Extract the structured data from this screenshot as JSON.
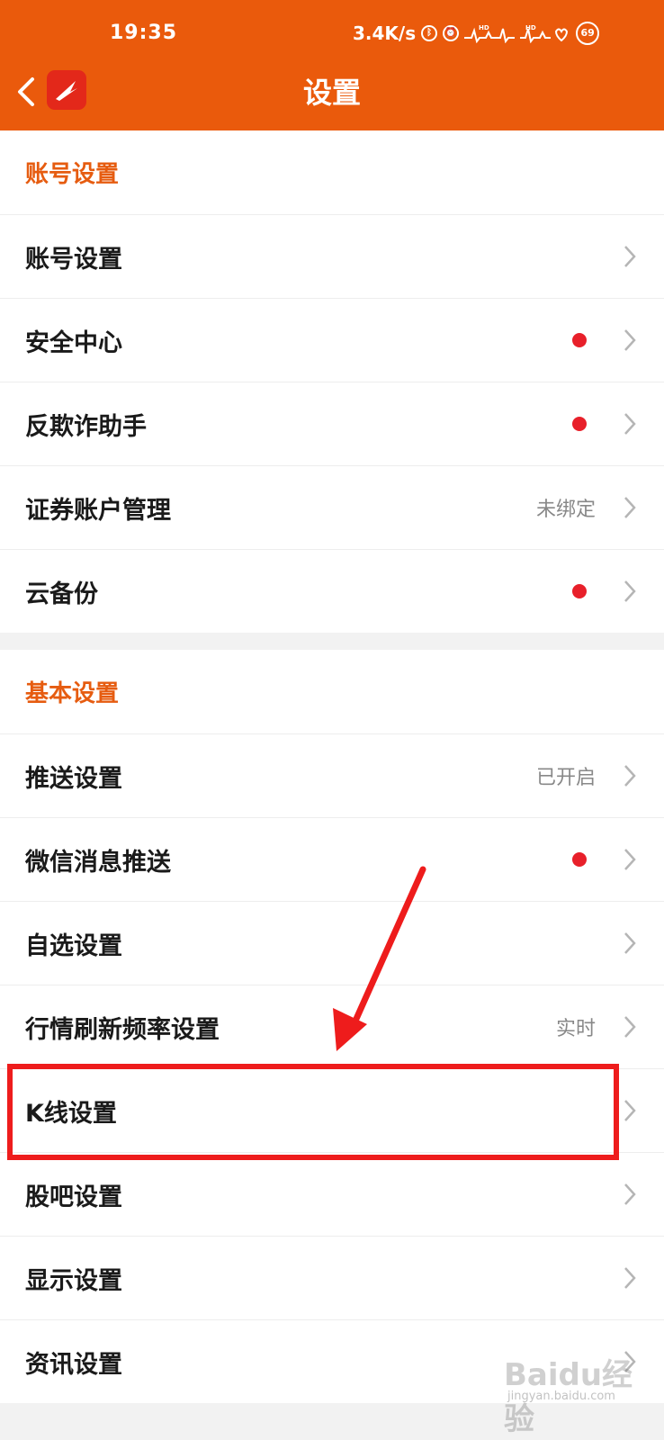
{
  "status_bar": {
    "time": "19:35",
    "network_speed": "3.4K/s",
    "battery_level": "69",
    "icons": [
      "bluetooth-icon",
      "alarm-icon",
      "hd-signal-icon",
      "hd-signal-icon",
      "heart-icon"
    ]
  },
  "header": {
    "title": "设置",
    "back_icon": "chevron-left-icon",
    "logo_icon": "app-logo-icon"
  },
  "account_section": {
    "title": "账号设置",
    "items": [
      {
        "label": "账号设置",
        "value": "",
        "dot": false
      },
      {
        "label": "安全中心",
        "value": "",
        "dot": true
      },
      {
        "label": "反欺诈助手",
        "value": "",
        "dot": true
      },
      {
        "label": "证券账户管理",
        "value": "未绑定",
        "dot": false
      },
      {
        "label": "云备份",
        "value": "",
        "dot": true
      }
    ]
  },
  "basic_section": {
    "title": "基本设置",
    "items": [
      {
        "label": "推送设置",
        "value": "已开启",
        "dot": false
      },
      {
        "label": "微信消息推送",
        "value": "",
        "dot": true
      },
      {
        "label": "自选设置",
        "value": "",
        "dot": false
      },
      {
        "label": "行情刷新频率设置",
        "value": "实时",
        "dot": false
      },
      {
        "label": "K线设置",
        "value": "",
        "dot": false
      },
      {
        "label": "股吧设置",
        "value": "",
        "dot": false
      },
      {
        "label": "显示设置",
        "value": "",
        "dot": false
      },
      {
        "label": "资讯设置",
        "value": "",
        "dot": false
      }
    ]
  },
  "annotation": {
    "highlighted_item": "K线设置",
    "color": "#ee1c1c"
  },
  "watermark": {
    "logo": "Baidu经验",
    "url": "jingyan.baidu.com"
  },
  "colors": {
    "brand": "#ea5a0c",
    "section_title": "#e65c10",
    "dot": "#e8202a"
  }
}
